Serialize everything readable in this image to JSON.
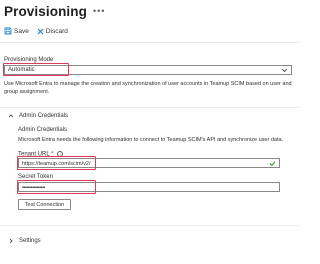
{
  "header": {
    "title": "Provisioning",
    "more_icon": "ellipsis-icon"
  },
  "toolbar": {
    "save_label": "Save",
    "discard_label": "Discard",
    "save_icon": "save-icon",
    "discard_icon": "close-icon",
    "icon_color": "#0078d4"
  },
  "provisioning_mode": {
    "label": "Provisioning Mode",
    "value": "Automatic"
  },
  "description": "Use Microsoft Entra to manage the creation and synchronization of user accounts in Teamup SCIM based on user and group assignment.",
  "admin_credentials": {
    "section_label": "Admin Credentials",
    "title": "Admin Credentials",
    "description": "Microsoft Entra needs the following information to connect to Teamup SCIM's API and synchronize user data.",
    "tenant_url": {
      "label": "Tenant URL",
      "required_mark": "*",
      "value": "https://teamup.com/scim/v2/"
    },
    "secret_token": {
      "label": "Secret Token",
      "value": "••••••••••••••••"
    },
    "test_connection_label": "Test Connection"
  },
  "settings": {
    "section_label": "Settings"
  },
  "colors": {
    "highlight": "#e03c5a",
    "valid_check": "#107c10"
  }
}
